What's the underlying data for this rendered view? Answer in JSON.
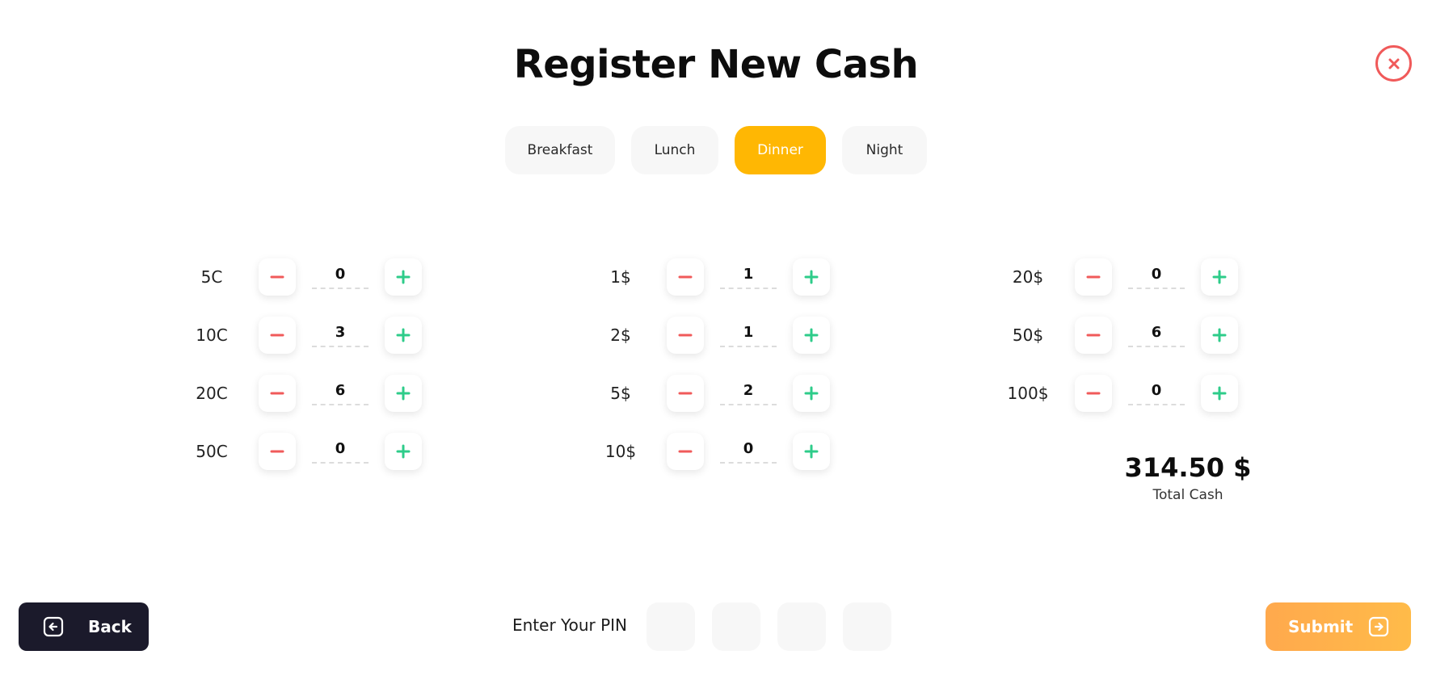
{
  "title": "Register New Cash",
  "close": {
    "icon": "close-icon",
    "color": "#f05a5a"
  },
  "tabs": [
    {
      "label": "Breakfast",
      "active": false
    },
    {
      "label": "Lunch",
      "active": false
    },
    {
      "label": "Dinner",
      "active": true
    },
    {
      "label": "Night",
      "active": false
    }
  ],
  "colors": {
    "accent": "#ffb703",
    "minus": "#f05a5a",
    "plus": "#2ecc8a",
    "dark": "#1b1a2b"
  },
  "denominations": [
    {
      "label": "5C",
      "qty": "0"
    },
    {
      "label": "10C",
      "qty": "3"
    },
    {
      "label": "20C",
      "qty": "6"
    },
    {
      "label": "50C",
      "qty": "0"
    },
    {
      "label": "1$",
      "qty": "1"
    },
    {
      "label": "2$",
      "qty": "1"
    },
    {
      "label": "5$",
      "qty": "2"
    },
    {
      "label": "10$",
      "qty": "0"
    },
    {
      "label": "20$",
      "qty": "0"
    },
    {
      "label": "50$",
      "qty": "6"
    },
    {
      "label": "100$",
      "qty": "0"
    }
  ],
  "total": {
    "value": "314.50 $",
    "label": "Total Cash"
  },
  "footer": {
    "back_label": "Back",
    "back_icon": "arrow-left-box-icon",
    "pin_label": "Enter Your PIN",
    "pin_length": 4,
    "submit_label": "Submit",
    "submit_icon": "arrow-right-box-icon"
  }
}
